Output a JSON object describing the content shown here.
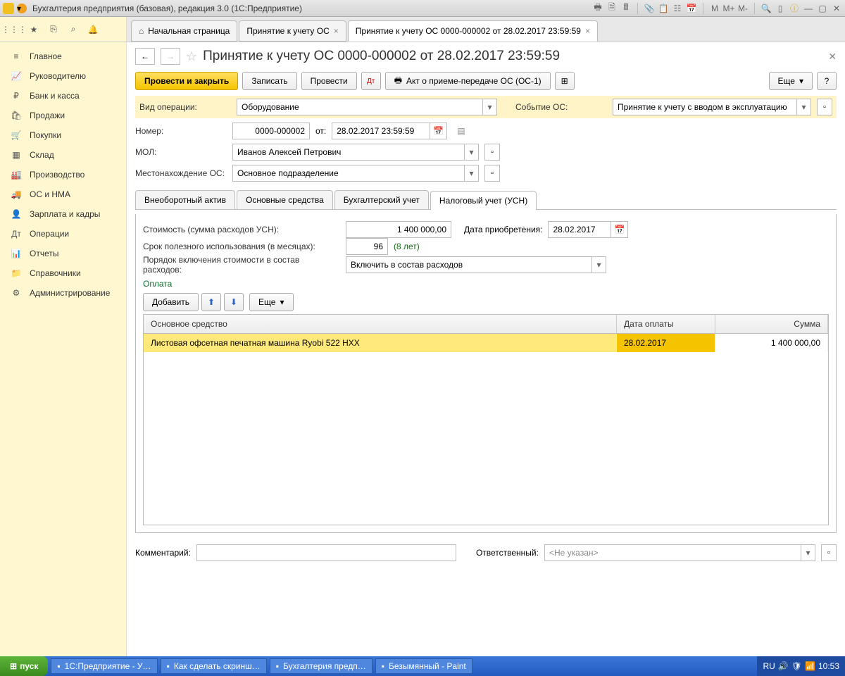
{
  "window": {
    "title": "Бухгалтерия предприятия (базовая), редакция 3.0  (1С:Предприятие)",
    "tb_text": {
      "m": "M",
      "mplus": "M+",
      "mminus": "M-"
    }
  },
  "toptabs": [
    {
      "label": "Начальная страница",
      "home": true
    },
    {
      "label": "Принятие к учету ОС"
    },
    {
      "label": "Принятие к учету ОС 0000-000002 от 28.02.2017 23:59:59",
      "active": true
    }
  ],
  "sidebar": {
    "items": [
      {
        "icon": "≡",
        "label": "Главное"
      },
      {
        "icon": "📈",
        "label": "Руководителю"
      },
      {
        "icon": "₽",
        "label": "Банк и касса"
      },
      {
        "icon": "🛍",
        "label": "Продажи"
      },
      {
        "icon": "🛒",
        "label": "Покупки"
      },
      {
        "icon": "▦",
        "label": "Склад"
      },
      {
        "icon": "🏭",
        "label": "Производство"
      },
      {
        "icon": "🚚",
        "label": "ОС и НМА"
      },
      {
        "icon": "👤",
        "label": "Зарплата и кадры"
      },
      {
        "icon": "Дт",
        "label": "Операции"
      },
      {
        "icon": "📊",
        "label": "Отчеты"
      },
      {
        "icon": "📁",
        "label": "Справочники"
      },
      {
        "icon": "⚙",
        "label": "Администрирование"
      }
    ]
  },
  "page": {
    "title": "Принятие к учету ОС 0000-000002 от 28.02.2017 23:59:59",
    "buttons": {
      "approve_close": "Провести и закрыть",
      "save": "Записать",
      "approve": "Провести",
      "act": "Акт о приеме-передаче ОС (ОС-1)",
      "more": "Еще",
      "help": "?"
    },
    "fields": {
      "op_type_label": "Вид операции:",
      "op_type": "Оборудование",
      "event_label": "Событие ОС:",
      "event": "Принятие к учету с вводом в эксплуатацию",
      "number_label": "Номер:",
      "number": "0000-000002",
      "from_label": "от:",
      "date": "28.02.2017 23:59:59",
      "mol_label": "МОЛ:",
      "mol": "Иванов Алексей Петрович",
      "location_label": "Местонахождение ОС:",
      "location": "Основное подразделение"
    },
    "ftabs": [
      "Внеоборотный актив",
      "Основные средства",
      "Бухгалтерский учет",
      "Налоговый учет (УСН)"
    ],
    "active_ftab": 3,
    "usn": {
      "cost_label": "Стоимость (сумма расходов УСН):",
      "cost": "1 400 000,00",
      "acq_date_label": "Дата приобретения:",
      "acq_date": "28.02.2017",
      "useful_life_label": "Срок полезного использования (в месяцах):",
      "useful_life": "96",
      "useful_life_hint": "(8 лет)",
      "order_label": "Порядок включения стоимости в состав расходов:",
      "order": "Включить в состав расходов",
      "section": "Оплата",
      "add_btn": "Добавить",
      "more": "Еще",
      "grid": {
        "cols": [
          "Основное средство",
          "Дата оплаты",
          "Сумма"
        ],
        "row": {
          "name": "Листовая офсетная печатная машина Ryobi 522 HXX",
          "date": "28.02.2017",
          "sum": "1 400 000,00"
        }
      }
    },
    "footer": {
      "comment_label": "Комментарий:",
      "responsible_label": "Ответственный:",
      "responsible": "<Не указан>"
    }
  },
  "taskbar": {
    "start": "пуск",
    "tasks": [
      "1С:Предприятие - У…",
      "Как сделать скринш…",
      "Бухгалтерия предп…",
      "Безымянный - Paint"
    ],
    "lang": "RU",
    "time": "10:53"
  }
}
